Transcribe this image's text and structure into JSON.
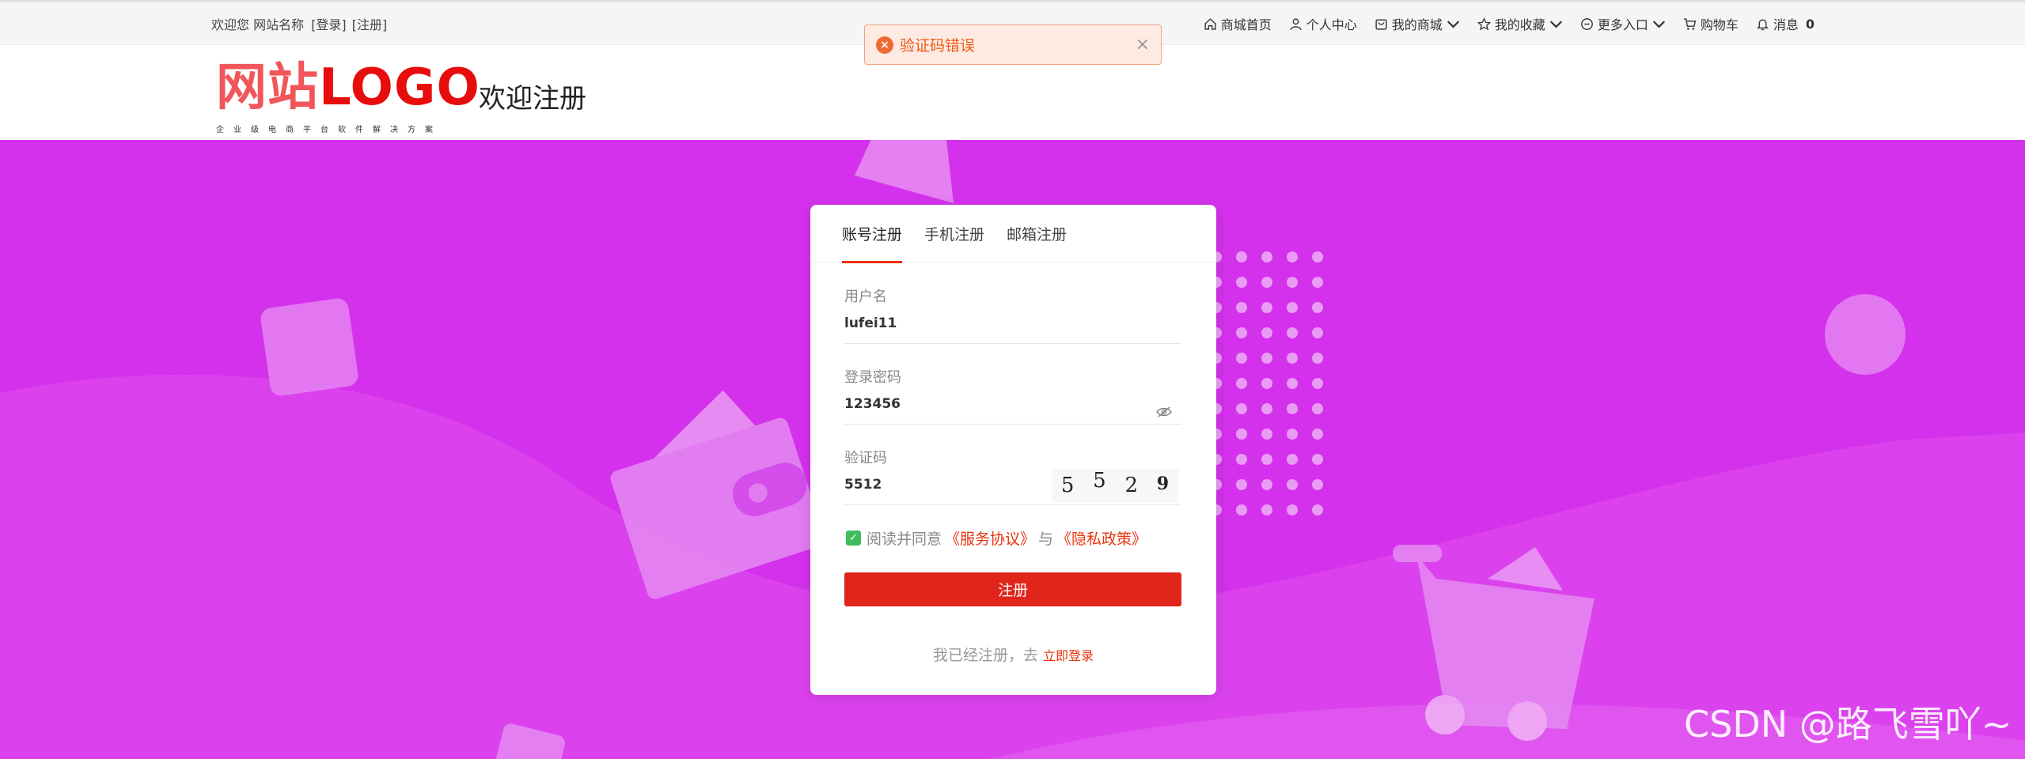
{
  "topbar": {
    "welcome": "欢迎您 网站名称",
    "login_link": "[登录]",
    "register_link": "[注册]",
    "nav": [
      {
        "label": "商城首页",
        "icon": "home-icon",
        "dropdown": false
      },
      {
        "label": "个人中心",
        "icon": "user-icon",
        "dropdown": false
      },
      {
        "label": "我的商城",
        "icon": "shop-icon",
        "dropdown": true
      },
      {
        "label": "我的收藏",
        "icon": "star-icon",
        "dropdown": true
      },
      {
        "label": "更多入口",
        "icon": "more-icon",
        "dropdown": true
      },
      {
        "label": "购物车",
        "icon": "cart-icon",
        "dropdown": false
      },
      {
        "label": "消息",
        "icon": "bell-icon",
        "dropdown": false,
        "count": "0"
      }
    ]
  },
  "header": {
    "logo_cn": "网站",
    "logo_en": "LOGO",
    "logo_sub": "企业级电商平台软件解决方案",
    "title": "欢迎注册"
  },
  "alert": {
    "message": "验证码错误",
    "close": "×",
    "icon": "error-icon"
  },
  "form": {
    "tabs": [
      {
        "label": "账号注册",
        "active": true
      },
      {
        "label": "手机注册",
        "active": false
      },
      {
        "label": "邮箱注册",
        "active": false
      }
    ],
    "username": {
      "label": "用户名",
      "value": "lufei11"
    },
    "password": {
      "label": "登录密码",
      "value": "123456"
    },
    "captcha": {
      "label": "验证码",
      "value": "5512",
      "image_chars": [
        "5",
        "5",
        "2",
        "9"
      ]
    },
    "agree": {
      "checked": true,
      "prefix": "阅读并同意",
      "terms": "《服务协议》",
      "and": "与",
      "privacy": "《隐私政策》"
    },
    "submit_label": "注册",
    "footer": {
      "text": "我已经注册，去",
      "link": "立即登录"
    }
  },
  "watermark": "CSDN @路飞雪吖~",
  "colors": {
    "hero_bg": "#d431ec",
    "accent": "#e1251b",
    "alert_bg": "#fdebe3",
    "alert_text": "#ef5a18",
    "checkbox": "#3fbd5d"
  }
}
